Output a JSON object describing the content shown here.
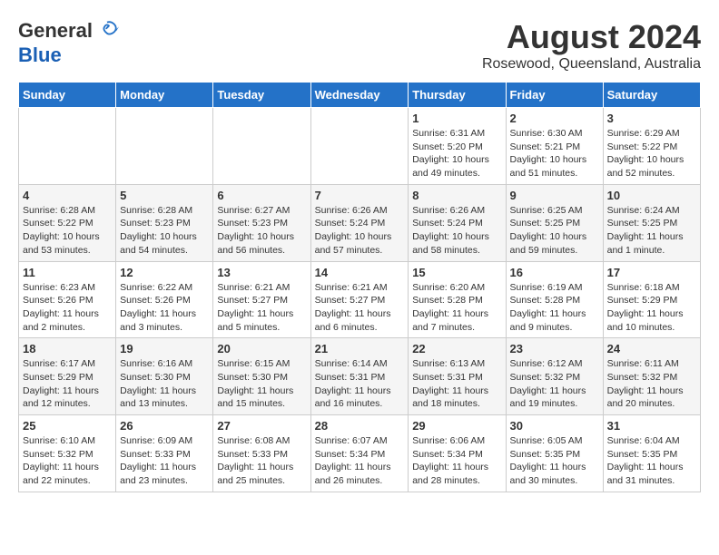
{
  "header": {
    "logo_general": "General",
    "logo_blue": "Blue",
    "month_year": "August 2024",
    "location": "Rosewood, Queensland, Australia"
  },
  "days_of_week": [
    "Sunday",
    "Monday",
    "Tuesday",
    "Wednesday",
    "Thursday",
    "Friday",
    "Saturday"
  ],
  "weeks": [
    [
      {
        "day": "",
        "sunrise": "",
        "sunset": "",
        "daylight": ""
      },
      {
        "day": "",
        "sunrise": "",
        "sunset": "",
        "daylight": ""
      },
      {
        "day": "",
        "sunrise": "",
        "sunset": "",
        "daylight": ""
      },
      {
        "day": "",
        "sunrise": "",
        "sunset": "",
        "daylight": ""
      },
      {
        "day": "1",
        "sunrise": "6:31 AM",
        "sunset": "5:20 PM",
        "daylight": "10 hours and 49 minutes."
      },
      {
        "day": "2",
        "sunrise": "6:30 AM",
        "sunset": "5:21 PM",
        "daylight": "10 hours and 51 minutes."
      },
      {
        "day": "3",
        "sunrise": "6:29 AM",
        "sunset": "5:22 PM",
        "daylight": "10 hours and 52 minutes."
      }
    ],
    [
      {
        "day": "4",
        "sunrise": "6:28 AM",
        "sunset": "5:22 PM",
        "daylight": "10 hours and 53 minutes."
      },
      {
        "day": "5",
        "sunrise": "6:28 AM",
        "sunset": "5:23 PM",
        "daylight": "10 hours and 54 minutes."
      },
      {
        "day": "6",
        "sunrise": "6:27 AM",
        "sunset": "5:23 PM",
        "daylight": "10 hours and 56 minutes."
      },
      {
        "day": "7",
        "sunrise": "6:26 AM",
        "sunset": "5:24 PM",
        "daylight": "10 hours and 57 minutes."
      },
      {
        "day": "8",
        "sunrise": "6:26 AM",
        "sunset": "5:24 PM",
        "daylight": "10 hours and 58 minutes."
      },
      {
        "day": "9",
        "sunrise": "6:25 AM",
        "sunset": "5:25 PM",
        "daylight": "10 hours and 59 minutes."
      },
      {
        "day": "10",
        "sunrise": "6:24 AM",
        "sunset": "5:25 PM",
        "daylight": "11 hours and 1 minute."
      }
    ],
    [
      {
        "day": "11",
        "sunrise": "6:23 AM",
        "sunset": "5:26 PM",
        "daylight": "11 hours and 2 minutes."
      },
      {
        "day": "12",
        "sunrise": "6:22 AM",
        "sunset": "5:26 PM",
        "daylight": "11 hours and 3 minutes."
      },
      {
        "day": "13",
        "sunrise": "6:21 AM",
        "sunset": "5:27 PM",
        "daylight": "11 hours and 5 minutes."
      },
      {
        "day": "14",
        "sunrise": "6:21 AM",
        "sunset": "5:27 PM",
        "daylight": "11 hours and 6 minutes."
      },
      {
        "day": "15",
        "sunrise": "6:20 AM",
        "sunset": "5:28 PM",
        "daylight": "11 hours and 7 minutes."
      },
      {
        "day": "16",
        "sunrise": "6:19 AM",
        "sunset": "5:28 PM",
        "daylight": "11 hours and 9 minutes."
      },
      {
        "day": "17",
        "sunrise": "6:18 AM",
        "sunset": "5:29 PM",
        "daylight": "11 hours and 10 minutes."
      }
    ],
    [
      {
        "day": "18",
        "sunrise": "6:17 AM",
        "sunset": "5:29 PM",
        "daylight": "11 hours and 12 minutes."
      },
      {
        "day": "19",
        "sunrise": "6:16 AM",
        "sunset": "5:30 PM",
        "daylight": "11 hours and 13 minutes."
      },
      {
        "day": "20",
        "sunrise": "6:15 AM",
        "sunset": "5:30 PM",
        "daylight": "11 hours and 15 minutes."
      },
      {
        "day": "21",
        "sunrise": "6:14 AM",
        "sunset": "5:31 PM",
        "daylight": "11 hours and 16 minutes."
      },
      {
        "day": "22",
        "sunrise": "6:13 AM",
        "sunset": "5:31 PM",
        "daylight": "11 hours and 18 minutes."
      },
      {
        "day": "23",
        "sunrise": "6:12 AM",
        "sunset": "5:32 PM",
        "daylight": "11 hours and 19 minutes."
      },
      {
        "day": "24",
        "sunrise": "6:11 AM",
        "sunset": "5:32 PM",
        "daylight": "11 hours and 20 minutes."
      }
    ],
    [
      {
        "day": "25",
        "sunrise": "6:10 AM",
        "sunset": "5:32 PM",
        "daylight": "11 hours and 22 minutes."
      },
      {
        "day": "26",
        "sunrise": "6:09 AM",
        "sunset": "5:33 PM",
        "daylight": "11 hours and 23 minutes."
      },
      {
        "day": "27",
        "sunrise": "6:08 AM",
        "sunset": "5:33 PM",
        "daylight": "11 hours and 25 minutes."
      },
      {
        "day": "28",
        "sunrise": "6:07 AM",
        "sunset": "5:34 PM",
        "daylight": "11 hours and 26 minutes."
      },
      {
        "day": "29",
        "sunrise": "6:06 AM",
        "sunset": "5:34 PM",
        "daylight": "11 hours and 28 minutes."
      },
      {
        "day": "30",
        "sunrise": "6:05 AM",
        "sunset": "5:35 PM",
        "daylight": "11 hours and 30 minutes."
      },
      {
        "day": "31",
        "sunrise": "6:04 AM",
        "sunset": "5:35 PM",
        "daylight": "11 hours and 31 minutes."
      }
    ]
  ]
}
